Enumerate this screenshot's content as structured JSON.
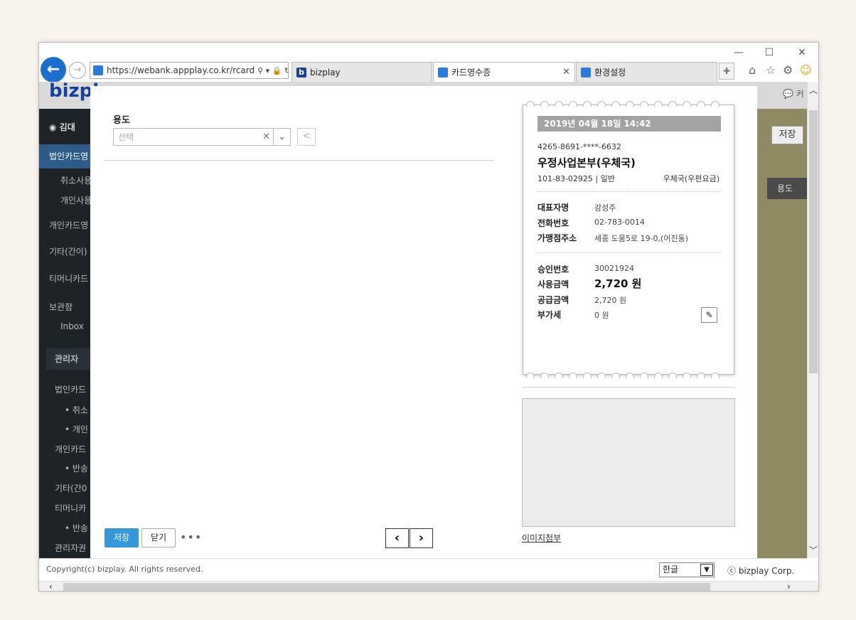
{
  "browser": {
    "url": "https://webank.appplay.co.kr/rcard",
    "tabs": [
      {
        "label": "bizplay",
        "active": false
      },
      {
        "label": "카드영수증",
        "active": true
      },
      {
        "label": "환경설정",
        "active": false
      }
    ]
  },
  "background": {
    "logo": "bizpl",
    "user": "김대",
    "sidebar": [
      "법인카드영",
      "취소사용",
      "개인사용",
      "개인카드영",
      "기타(간이)",
      "티머니카드",
      "보관함",
      "Inbox",
      "관리자",
      "법인카드",
      "• 취소",
      "• 개인",
      "개인카드",
      "• 반송",
      "기타(간0",
      "티머니카",
      "• 반송",
      "관리자권"
    ],
    "save": "저장",
    "col_header": "용도",
    "chat": "커"
  },
  "modal": {
    "usage_label": "용도",
    "select_placeholder": "선택",
    "save_label": "저장",
    "close_label": "닫기",
    "more_label": "•••",
    "prev_label": "‹",
    "next_label": "›",
    "image_attach": "이미지첨부"
  },
  "receipt": {
    "datetime": "2019년 04월 18일 14:42",
    "card_number": "4265-8691-****-6632",
    "merchant": "우정사업본부(우체국)",
    "biz_info": "101-83-02925 | 일반",
    "category": "우체국(우편요금)",
    "rows_info": [
      {
        "label": "대표자명",
        "value": "강성주"
      },
      {
        "label": "전화번호",
        "value": "02-783-0014"
      },
      {
        "label": "가맹점주소",
        "value": "세종 도움5로 19-0,(어진동)"
      }
    ],
    "rows_amount": [
      {
        "label": "승인번호",
        "value": "30021924"
      },
      {
        "label": "사용금액",
        "value": "2,720 원"
      },
      {
        "label": "공급금액",
        "value": "2,720 원"
      },
      {
        "label": "부가세",
        "value": "0 원"
      }
    ]
  },
  "footer": {
    "copyright": "Copyright(c) bizplay. All rights reserved.",
    "language": "한글",
    "corp": "ⓒ bizplay Corp."
  }
}
